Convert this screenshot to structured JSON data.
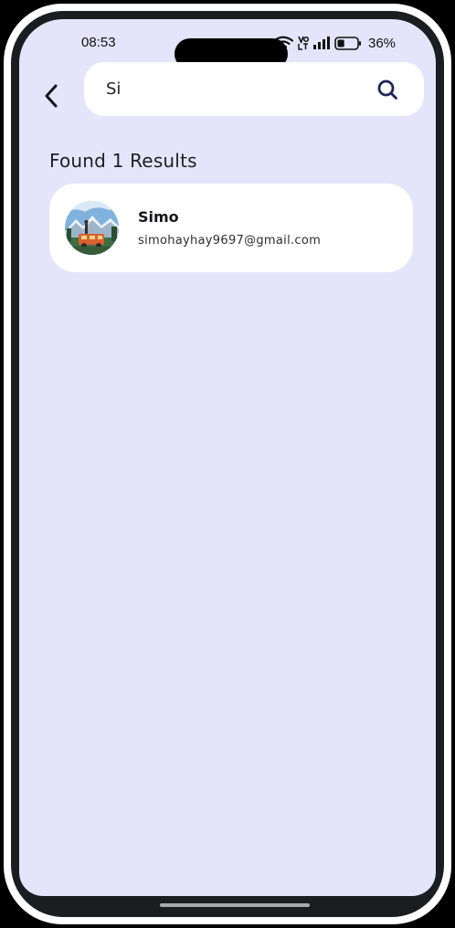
{
  "status_bar": {
    "time": "08:53",
    "battery_percent": "36%",
    "battery_level": 0.36,
    "icons": [
      "wifi-icon",
      "volte-icon",
      "signal-icon",
      "battery-icon"
    ]
  },
  "header": {
    "back_icon": "chevron-left-icon",
    "search": {
      "value": "Si",
      "placeholder": "",
      "icon": "search-icon"
    }
  },
  "results": {
    "heading": "Found 1 Results",
    "items": [
      {
        "name": "Simo",
        "email": "simohayhay9697@gmail.com",
        "avatar_icon": "avatar-photo"
      }
    ]
  },
  "colors": {
    "background": "#e5e4fb",
    "card": "#ffffff",
    "accent": "#1f2556",
    "text": "#1e1e24"
  }
}
